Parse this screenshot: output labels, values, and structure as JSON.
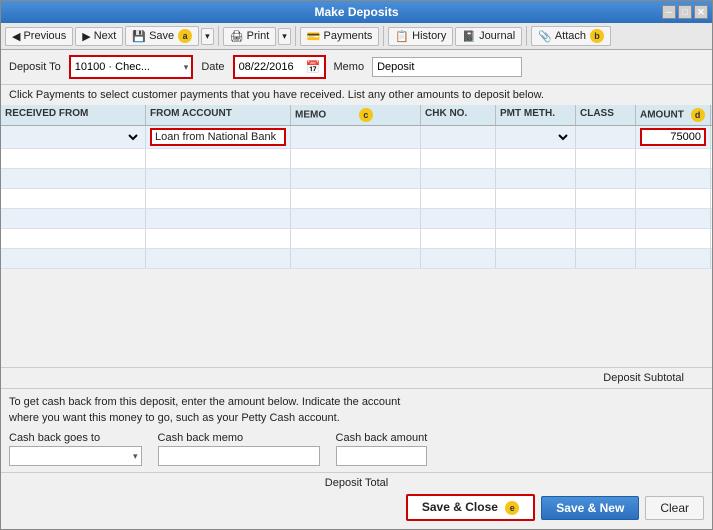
{
  "window": {
    "title": "Make Deposits"
  },
  "toolbar": {
    "previous_label": "Previous",
    "next_label": "Next",
    "save_label": "Save",
    "print_label": "Print",
    "payments_label": "Payments",
    "history_label": "History",
    "journal_label": "Journal",
    "attach_label": "Attach"
  },
  "form": {
    "deposit_to_label": "Deposit To",
    "deposit_to_value": "10100 · Chec...",
    "date_label": "Date",
    "date_value": "08/22/2016",
    "memo_label": "Memo",
    "memo_value": "Deposit"
  },
  "info_text": "Click Payments to select customer payments that you have received. List any other amounts to deposit below.",
  "table": {
    "headers": [
      "RECEIVED FROM",
      "FROM ACCOUNT",
      "MEMO",
      "CHK NO.",
      "PMT METH.",
      "CLASS",
      "AMOUNT",
      ""
    ],
    "rows": [
      {
        "received_from": "",
        "from_account": "Loan from National Bank",
        "memo": "",
        "chk_no": "",
        "pmt_meth": "",
        "class": "",
        "amount": "75000"
      }
    ],
    "empty_rows": 8
  },
  "subtotal": {
    "label": "Deposit Subtotal"
  },
  "cash_back": {
    "info_line1": "To get cash back from this deposit, enter the amount below.  Indicate the account",
    "info_line2": "where you want this money to go, such as your Petty Cash account.",
    "goes_to_label": "Cash back goes to",
    "memo_label": "Cash back memo",
    "amount_label": "Cash back amount"
  },
  "deposit_total": {
    "label": "Deposit Total"
  },
  "buttons": {
    "save_close_label": "Save & Close",
    "save_new_label": "Save & New",
    "clear_label": "Clear"
  },
  "badges": {
    "a": "a",
    "b": "b",
    "c": "c",
    "d": "d",
    "e": "e"
  }
}
